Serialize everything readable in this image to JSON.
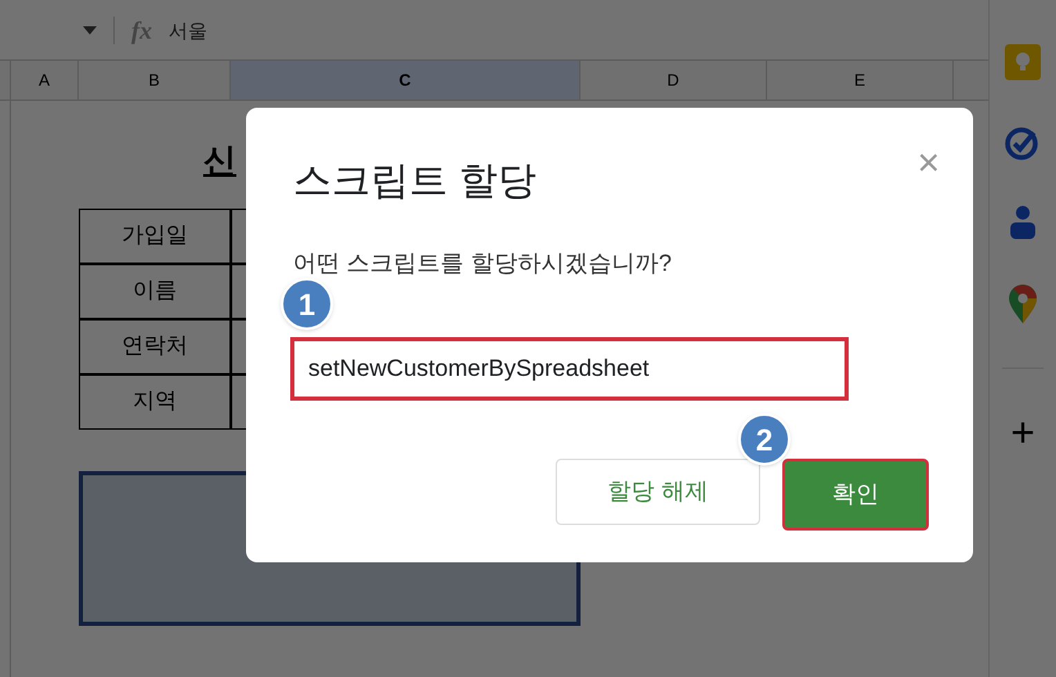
{
  "formula_bar": {
    "fx": "fx",
    "value": "서울"
  },
  "columns": [
    "A",
    "B",
    "C",
    "D",
    "E"
  ],
  "sheet": {
    "title": "신",
    "labels": [
      "가입일",
      "이름",
      "연락처",
      "지역"
    ]
  },
  "dialog": {
    "title": "스크립트 할당",
    "close": "×",
    "question": "어떤 스크립트를 할당하시겠습니까?",
    "value": "setNewCustomerBySpreadsheet",
    "buttons": [
      {
        "label": "할당 해제",
        "kind": "secondary"
      },
      {
        "label": "확인",
        "kind": "primary"
      }
    ]
  },
  "steps": [
    "1",
    "2"
  ],
  "side_panel": {
    "add": "+"
  }
}
